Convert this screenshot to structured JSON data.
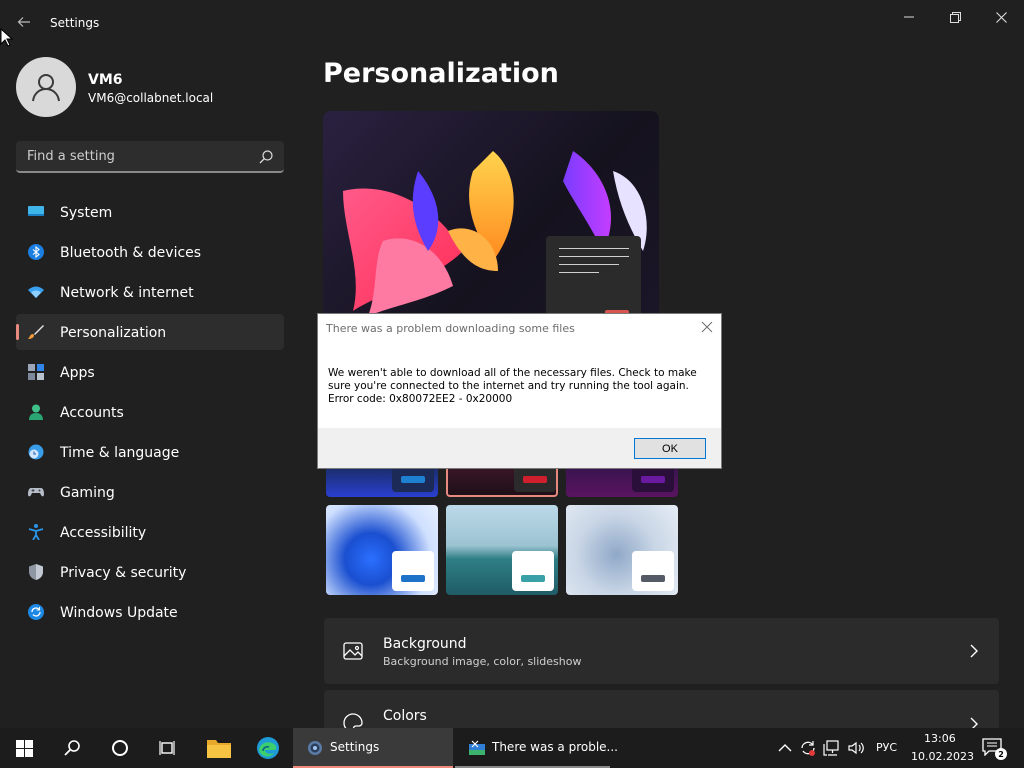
{
  "window": {
    "title": "Settings"
  },
  "user": {
    "name": "VM6",
    "email": "VM6@collabnet.local"
  },
  "search": {
    "placeholder": "Find a setting"
  },
  "sidebar": {
    "items": [
      {
        "label": "System",
        "icon": "monitor-icon"
      },
      {
        "label": "Bluetooth & devices",
        "icon": "bluetooth-icon"
      },
      {
        "label": "Network & internet",
        "icon": "wifi-icon"
      },
      {
        "label": "Personalization",
        "icon": "brush-icon",
        "active": true
      },
      {
        "label": "Apps",
        "icon": "apps-icon"
      },
      {
        "label": "Accounts",
        "icon": "person-icon"
      },
      {
        "label": "Time & language",
        "icon": "clock-globe-icon"
      },
      {
        "label": "Gaming",
        "icon": "gamepad-icon"
      },
      {
        "label": "Accessibility",
        "icon": "accessibility-icon"
      },
      {
        "label": "Privacy & security",
        "icon": "shield-icon"
      },
      {
        "label": "Windows Update",
        "icon": "update-icon"
      }
    ]
  },
  "main": {
    "title": "Personalization",
    "cards": [
      {
        "title": "Background",
        "subtitle": "Background image, color, slideshow",
        "icon": "image-icon"
      },
      {
        "title": "Colors",
        "subtitle": "",
        "icon": "palette-icon"
      }
    ]
  },
  "dialog": {
    "title": "There was a problem downloading some files",
    "message_line1": "We weren't able to download all of the necessary files. Check to make",
    "message_line2": "sure you're connected to the internet and try running the tool again.",
    "message_line3": "Error code: 0x80072EE2 - 0x20000",
    "ok_label": "OK"
  },
  "taskbar": {
    "tasks": [
      {
        "label": "Settings",
        "active": true
      },
      {
        "label": "There was a proble..."
      }
    ],
    "language": "РУС",
    "time": "13:06",
    "date": "10.02.2023",
    "notification_count": "2"
  },
  "colors": {
    "accent": "#f08a7c",
    "background": "#202020",
    "card": "#2b2b2b"
  }
}
